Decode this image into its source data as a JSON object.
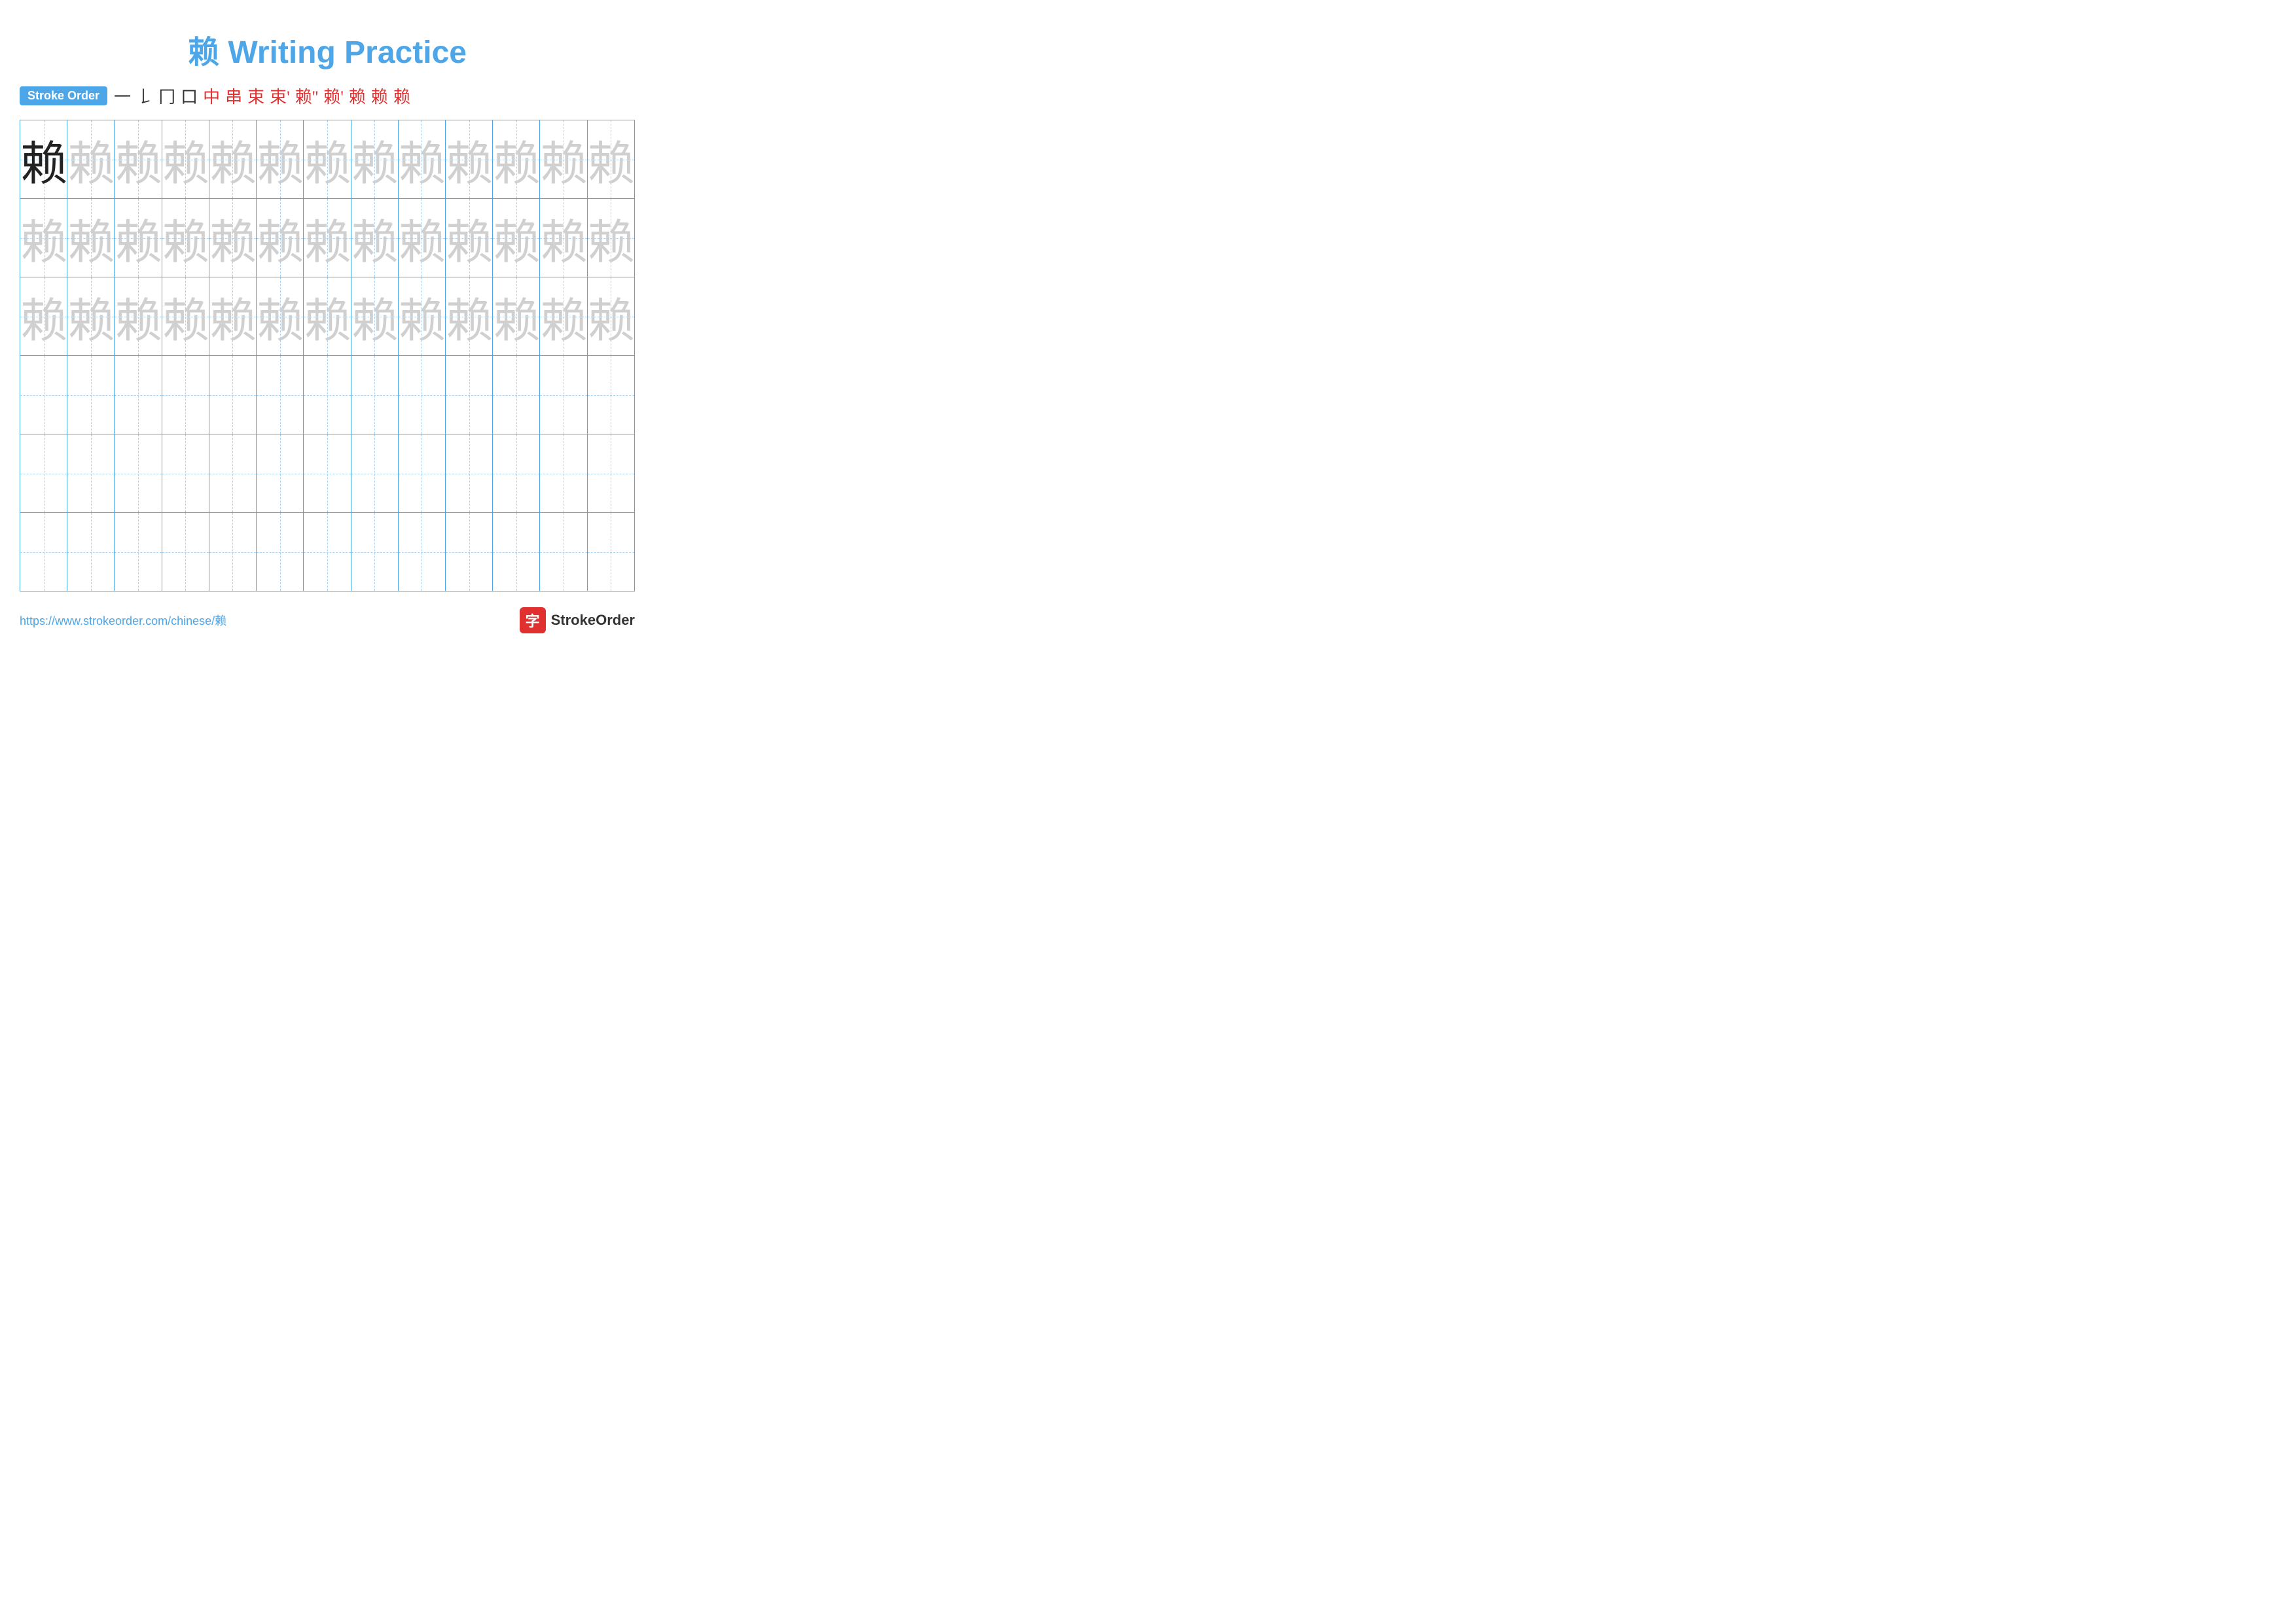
{
  "title": {
    "char": "赖",
    "text": "Writing Practice"
  },
  "stroke_order": {
    "badge": "Stroke Order",
    "strokes": [
      "一",
      "𠄌",
      "冂",
      "口",
      "中",
      "串",
      "束",
      "束'",
      "束''",
      "赖'",
      "赖''",
      "赖",
      "赖"
    ]
  },
  "grid": {
    "rows": 6,
    "cols": 13,
    "char": "赖",
    "row_types": [
      "dark_then_light",
      "light",
      "light",
      "empty",
      "empty",
      "empty"
    ]
  },
  "footer": {
    "url": "https://www.strokeorder.com/chinese/赖",
    "logo_char": "字",
    "logo_text": "StrokeOrder"
  }
}
